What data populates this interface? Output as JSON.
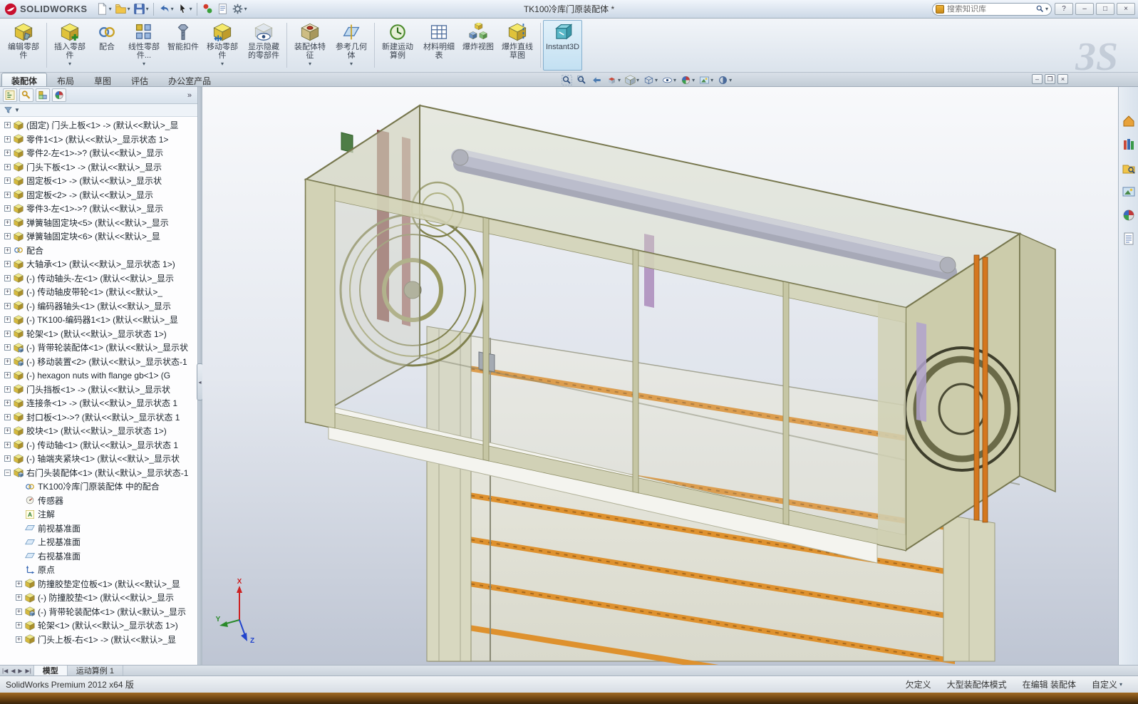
{
  "titlebar": {
    "app_name": "SOLIDWORKS",
    "doc_title": "TK100冷库门原装配体 *",
    "search": {
      "placeholder": "搜索知识库"
    },
    "window_buttons": [
      {
        "name": "help-button",
        "glyph": "?"
      },
      {
        "name": "minimize-button",
        "glyph": "–"
      },
      {
        "name": "restore-button",
        "glyph": "□"
      },
      {
        "name": "close-button",
        "glyph": "×"
      }
    ]
  },
  "quick_access": [
    {
      "icon": "new-doc-icon",
      "dropdown": true
    },
    {
      "icon": "open-icon",
      "dropdown": true
    },
    {
      "icon": "save-icon",
      "dropdown": true
    },
    {
      "icon": "undo-icon",
      "dropdown": true
    },
    {
      "icon": "select-icon",
      "dropdown": true
    },
    {
      "icon": "rebuild-icon",
      "dropdown": false
    },
    {
      "icon": "file-properties-icon",
      "dropdown": false
    },
    {
      "icon": "options-icon",
      "dropdown": true
    }
  ],
  "ribbon": {
    "watermark": "ЗS",
    "buttons": [
      {
        "label": "编辑零部件",
        "icon": "edit-component-icon",
        "dropdown": false,
        "active": false
      },
      {
        "label": "插入零部件",
        "icon": "insert-component-icon",
        "dropdown": true,
        "active": false
      },
      {
        "label": "配合",
        "icon": "mate-icon",
        "dropdown": false,
        "active": false
      },
      {
        "label": "线性零部件...",
        "icon": "linear-pattern-icon",
        "dropdown": true,
        "active": false
      },
      {
        "label": "智能扣件",
        "icon": "smart-fasteners-icon",
        "dropdown": false,
        "active": false
      },
      {
        "label": "移动零部件",
        "icon": "move-component-icon",
        "dropdown": true,
        "active": false
      },
      {
        "label": "显示隐藏的零部件",
        "icon": "show-hidden-icon",
        "dropdown": false,
        "active": false
      },
      {
        "label": "装配体特征",
        "icon": "assembly-features-icon",
        "dropdown": true,
        "active": false
      },
      {
        "label": "参考几何体",
        "icon": "reference-geometry-icon",
        "dropdown": true,
        "active": false
      },
      {
        "label": "新建运动算例",
        "icon": "motion-study-icon",
        "dropdown": false,
        "active": false
      },
      {
        "label": "材料明细表",
        "icon": "bom-icon",
        "dropdown": false,
        "active": false
      },
      {
        "label": "爆炸视图",
        "icon": "exploded-view-icon",
        "dropdown": false,
        "active": false
      },
      {
        "label": "爆炸直线草图",
        "icon": "explode-lines-icon",
        "dropdown": false,
        "active": false
      },
      {
        "label": "Instant3D",
        "icon": "instant3d-icon",
        "dropdown": false,
        "active": true
      }
    ]
  },
  "command_tabs": [
    {
      "label": "装配体",
      "active": true
    },
    {
      "label": "布局",
      "active": false
    },
    {
      "label": "草图",
      "active": false
    },
    {
      "label": "评估",
      "active": false
    },
    {
      "label": "办公室产品",
      "active": false
    }
  ],
  "headsup": [
    {
      "icon": "zoom-fit-icon",
      "dropdown": false
    },
    {
      "icon": "zoom-area-icon",
      "dropdown": false
    },
    {
      "icon": "previous-view-icon",
      "dropdown": false
    },
    {
      "icon": "section-view-icon",
      "dropdown": true
    },
    {
      "icon": "view-orientation-icon",
      "dropdown": true
    },
    {
      "icon": "display-style-icon",
      "dropdown": true
    },
    {
      "icon": "hide-show-items-icon",
      "dropdown": true
    },
    {
      "icon": "edit-appearance-icon",
      "dropdown": true
    },
    {
      "icon": "apply-scene-icon",
      "dropdown": true
    },
    {
      "icon": "view-settings-icon",
      "dropdown": true
    }
  ],
  "doc_window_buttons": [
    {
      "name": "doc-minimize-button",
      "glyph": "–"
    },
    {
      "name": "doc-restore-button",
      "glyph": "❐"
    },
    {
      "name": "doc-close-button",
      "glyph": "×"
    }
  ],
  "panel": {
    "tabs": [
      "feature-manager-tab-icon",
      "property-manager-tab-icon",
      "configuration-manager-tab-icon",
      "display-manager-tab-icon"
    ],
    "overflow": "»",
    "filter": {
      "icon": "filter-icon",
      "dropdown": "▼"
    }
  },
  "tree": {
    "items": [
      {
        "indent": 1,
        "expander": "+",
        "icon": "part-icon",
        "label": "(固定) 门头上板<1> -> (默认<<默认>_显"
      },
      {
        "indent": 1,
        "expander": "+",
        "icon": "part-icon",
        "label": "零件1<1> (默认<<默认>_显示状态 1>"
      },
      {
        "indent": 1,
        "expander": "+",
        "icon": "part-icon",
        "label": "零件2-左<1>->? (默认<<默认>_显示"
      },
      {
        "indent": 1,
        "expander": "+",
        "icon": "part-icon",
        "label": "门头下板<1> -> (默认<<默认>_显示"
      },
      {
        "indent": 1,
        "expander": "+",
        "icon": "part-icon",
        "label": "固定板<1> -> (默认<<默认>_显示状"
      },
      {
        "indent": 1,
        "expander": "+",
        "icon": "part-icon",
        "label": "固定板<2> -> (默认<<默认>_显示"
      },
      {
        "indent": 1,
        "expander": "+",
        "icon": "part-icon",
        "label": "零件3-左<1>->? (默认<<默认>_显示"
      },
      {
        "indent": 1,
        "expander": "+",
        "icon": "part-icon",
        "label": "弹簧轴固定块<5> (默认<<默认>_显示"
      },
      {
        "indent": 1,
        "expander": "+",
        "icon": "part-icon",
        "label": "弹簧轴固定块<6> (默认<<默认>_显"
      },
      {
        "indent": 1,
        "expander": "+",
        "icon": "mates-icon",
        "label": "配合"
      },
      {
        "indent": 1,
        "expander": "+",
        "icon": "part-icon",
        "label": "大轴承<1> (默认<<默认>_显示状态 1>)"
      },
      {
        "indent": 1,
        "expander": "+",
        "icon": "part-icon",
        "label": "(-) 传动轴头-左<1> (默认<<默认>_显示"
      },
      {
        "indent": 1,
        "expander": "+",
        "icon": "part-icon",
        "label": "(-) 传动轴皮带轮<1> (默认<<默认>_"
      },
      {
        "indent": 1,
        "expander": "+",
        "icon": "part-icon",
        "label": "(-) 编码器轴头<1> (默认<<默认>_显示"
      },
      {
        "indent": 1,
        "expander": "+",
        "icon": "part-icon",
        "label": "(-) TK100-编码器1<1> (默认<<默认>_显"
      },
      {
        "indent": 1,
        "expander": "+",
        "icon": "part-icon",
        "label": "轮架<1> (默认<<默认>_显示状态 1>)"
      },
      {
        "indent": 1,
        "expander": "+",
        "icon": "assembly-icon",
        "label": "(-) 背带轮装配体<1> (默认<<默认>_显示状"
      },
      {
        "indent": 1,
        "expander": "+",
        "icon": "assembly-icon",
        "label": "(-) 移动装置<2> (默认<<默认>_显示状态-1"
      },
      {
        "indent": 1,
        "expander": "+",
        "icon": "part-icon",
        "label": "(-) hexagon nuts with flange gb<1> (G"
      },
      {
        "indent": 1,
        "expander": "+",
        "icon": "part-icon",
        "label": "门头挡板<1> -> (默认<<默认>_显示状"
      },
      {
        "indent": 1,
        "expander": "+",
        "icon": "part-icon",
        "label": "连接条<1> -> (默认<<默认>_显示状态 1"
      },
      {
        "indent": 1,
        "expander": "+",
        "icon": "part-icon",
        "label": "封口板<1>->? (默认<<默认>_显示状态 1"
      },
      {
        "indent": 1,
        "expander": "+",
        "icon": "part-icon",
        "label": "胶块<1> (默认<<默认>_显示状态 1>)"
      },
      {
        "indent": 1,
        "expander": "+",
        "icon": "part-icon",
        "label": "(-) 传动轴<1> (默认<<默认>_显示状态 1"
      },
      {
        "indent": 1,
        "expander": "+",
        "icon": "part-icon",
        "label": "(-) 轴端夹紧块<1> (默认<<默认>_显示状"
      },
      {
        "indent": 1,
        "expander": "-",
        "icon": "assembly-icon",
        "label": "右门头装配体<1> (默认<默认>_显示状态-1"
      },
      {
        "indent": 2,
        "expander": "",
        "icon": "mates-icon",
        "label": "TK100冷库门原装配体 中的配合"
      },
      {
        "indent": 2,
        "expander": "",
        "icon": "sensor-icon",
        "label": "传感器"
      },
      {
        "indent": 2,
        "expander": "",
        "icon": "annotation-icon",
        "label": "注解"
      },
      {
        "indent": 2,
        "expander": "",
        "icon": "plane-icon",
        "label": "前视基准面"
      },
      {
        "indent": 2,
        "expander": "",
        "icon": "plane-icon",
        "label": "上视基准面"
      },
      {
        "indent": 2,
        "expander": "",
        "icon": "plane-icon",
        "label": "右视基准面"
      },
      {
        "indent": 2,
        "expander": "",
        "icon": "origin-icon",
        "label": "原点"
      },
      {
        "indent": 2,
        "expander": "+",
        "icon": "part-icon",
        "label": "防撞胶垫定位板<1> (默认<<默认>_显"
      },
      {
        "indent": 2,
        "expander": "+",
        "icon": "part-icon",
        "label": "(-) 防撞胶垫<1> (默认<<默认>_显示"
      },
      {
        "indent": 2,
        "expander": "+",
        "icon": "assembly-icon",
        "label": "(-) 背带轮装配体<1> (默认<默认>_显示"
      },
      {
        "indent": 2,
        "expander": "+",
        "icon": "part-icon",
        "label": "轮架<1> (默认<<默认>_显示状态 1>)"
      },
      {
        "indent": 2,
        "expander": "+",
        "icon": "part-icon",
        "label": "门头上板-右<1> -> (默认<<默认>_显"
      }
    ]
  },
  "taskpane": [
    "resources-icon",
    "design-library-icon",
    "file-explorer-icon",
    "view-palette-icon",
    "appearances-icon",
    "custom-properties-icon"
  ],
  "viewport": {
    "triad": {
      "x": "X",
      "y": "Y",
      "z": "Z"
    }
  },
  "model_tabs": {
    "nav": [
      "|◀",
      "◀",
      "▶",
      "▶|"
    ],
    "tabs": [
      {
        "label": "模型",
        "active": true
      },
      {
        "label": "运动算例 1",
        "active": false
      }
    ]
  },
  "statusbar": {
    "left": "SolidWorks Premium 2012 x64 版",
    "items": [
      {
        "label": "欠定义",
        "dropdown": false
      },
      {
        "label": "大型装配体模式",
        "dropdown": false
      },
      {
        "label": "在编辑 装配体",
        "dropdown": false
      },
      {
        "label": "自定义",
        "dropdown": true
      }
    ]
  }
}
